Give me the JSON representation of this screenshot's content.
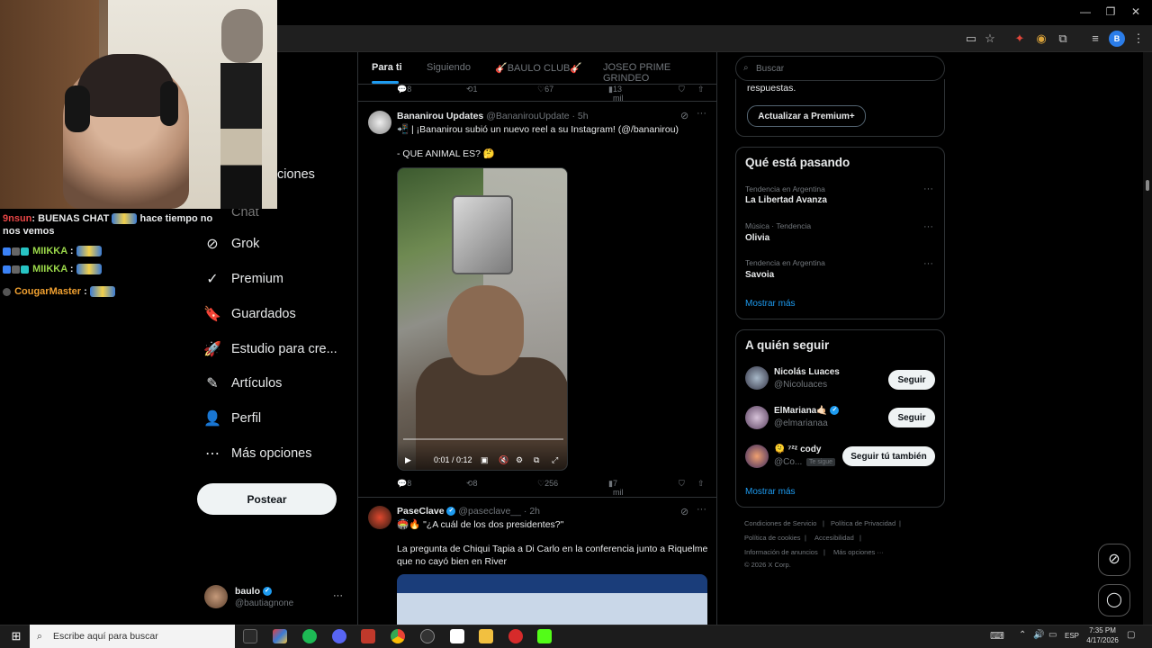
{
  "colors": {
    "accent": "#1d9bf0",
    "background": "#000000",
    "border": "#2f3336",
    "muted": "#71767b"
  },
  "window": {
    "minimize": "—",
    "maximize": "❐",
    "close": "✕"
  },
  "profile_chip": "B",
  "chat": {
    "lines": [
      {
        "user": "9nsun",
        "user_color": "#e84545",
        "text": ": BUENAS CHAT",
        "text2": "hace tiempo no nos vemos"
      },
      {
        "user": "MIIKKA",
        "user_color": "#9bd84a",
        "text": ":"
      },
      {
        "user": "MIIKKA",
        "user_color": "#9bd84a",
        "text": ":"
      },
      {
        "user": "CougarMaster",
        "user_color": "#f0a030",
        "text": ":"
      }
    ]
  },
  "nav": {
    "notifications_partial": "ciones",
    "chat_partial": "Chat",
    "items": [
      {
        "label": "Grok",
        "icon": "⊘"
      },
      {
        "label": "Premium",
        "icon": "✓"
      },
      {
        "label": "Guardados",
        "icon": "🔖"
      },
      {
        "label": "Estudio para cre...",
        "icon": "🚀"
      },
      {
        "label": "Artículos",
        "icon": "✎"
      },
      {
        "label": "Perfil",
        "icon": "👤"
      },
      {
        "label": "Más opciones",
        "icon": "⋯"
      }
    ],
    "post_label": "Postear",
    "account": {
      "name": "baulo",
      "handle": "@bautiagnone",
      "more": "···"
    }
  },
  "timeline": {
    "tabs": [
      "Para ti",
      "Siguiendo",
      "🎸BAULO CLUB🎸",
      "JOSEO PRIME GRINDEO"
    ],
    "prev_actions": {
      "replies": "8",
      "reposts": "1",
      "likes": "67",
      "views": "13 mil"
    },
    "tweet1": {
      "name": "Bananirou Updates",
      "handle": "@BananirouUpdate · 5h",
      "line1": "📲 | ¡Bananirou subió un nuevo reel a su Instagram! (@/bananirou)",
      "line2": "- QUE ANIMAL ES? 🤔",
      "video_time": "0:01 / 0:12",
      "actions": {
        "replies": "8",
        "reposts": "8",
        "likes": "256",
        "views": "7 mil"
      }
    },
    "tweet2": {
      "name": "PaseClave",
      "handle": "@paseclave__ · 2h",
      "line1": "🏟️🔥 \"¿A cuál de los dos presidentes?\"",
      "line2": "La pregunta de Chiqui Tapia a Di Carlo en la conferencia junto a Riquelme que no cayó bien en River"
    }
  },
  "right": {
    "search_placeholder": "Buscar",
    "premium": {
      "text": "respuestas.",
      "button": "Actualizar a Premium+"
    },
    "trends": {
      "title": "Qué está pasando",
      "items": [
        {
          "context": "Tendencia en Argentina",
          "name": "La Libertad Avanza"
        },
        {
          "context": "Música · Tendencia",
          "name": "Olivia"
        },
        {
          "context": "Tendencia en Argentina",
          "name": "Savoia"
        }
      ],
      "more": "Mostrar más"
    },
    "follow": {
      "title": "A quién seguir",
      "items": [
        {
          "name": "Nicolás Luaces",
          "handle": "@Nicoluaces",
          "button": "Seguir"
        },
        {
          "name": "ElMariana🤙🏻",
          "handle": "@elmarianaa",
          "button": "Seguir"
        },
        {
          "name": "🫠 ⁷²ᶻ cody",
          "handle": "@Co...",
          "badge": "Te sigue",
          "button": "Seguir tú también"
        }
      ],
      "more": "Mostrar más"
    },
    "footer": [
      "Condiciones de Servicio",
      "|",
      "Política de Privacidad",
      "|",
      "Política de cookies",
      "|",
      "Accesibilidad",
      "|",
      "Información de anuncios",
      "|",
      "Más opciones ···",
      "© 2026 X Corp."
    ]
  },
  "taskbar": {
    "search_placeholder": "Escribe aquí para buscar",
    "lang": "ESP",
    "time": "7:35 PM",
    "date": "4/17/2026"
  }
}
